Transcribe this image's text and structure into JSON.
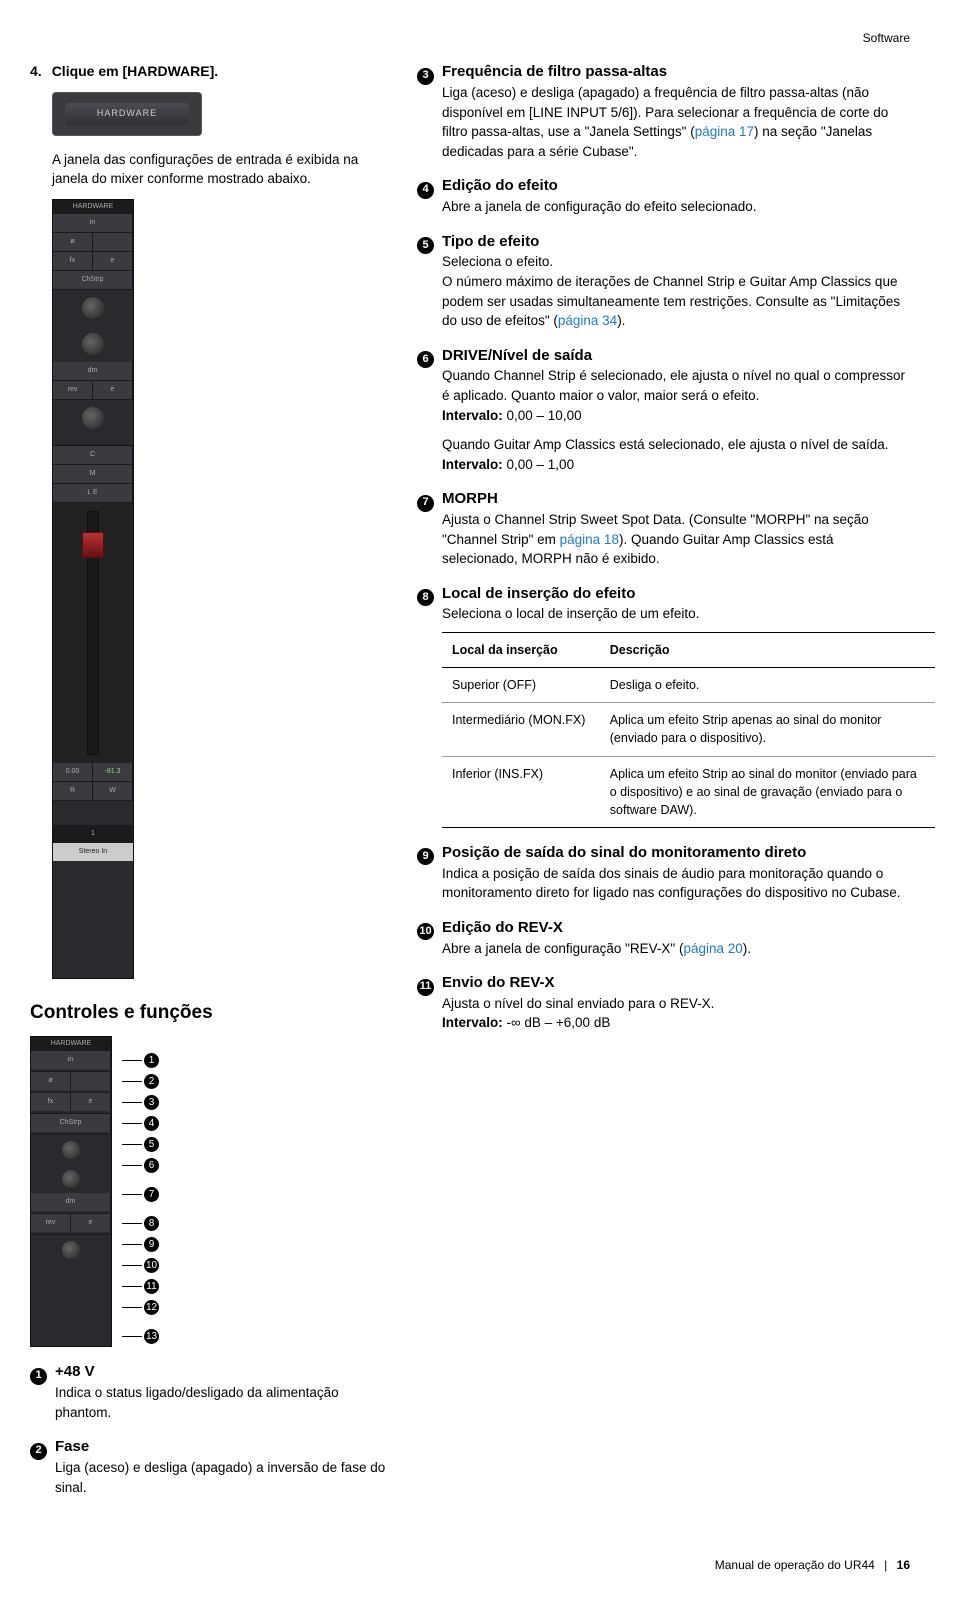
{
  "header": {
    "section": "Software"
  },
  "step": {
    "num": "4.",
    "text": "Clique em [HARDWARE].",
    "note": "A janela das configurações de entrada é exibida na janela do mixer conforme mostrado abaixo.",
    "thumbLabel": "HARDWARE"
  },
  "controls": {
    "heading": "Controles e funções",
    "panelTitle": "HARDWARE"
  },
  "items": {
    "i1": {
      "title": "+48 V",
      "body": "Indica o status ligado/desligado da alimentação phantom."
    },
    "i2": {
      "title": "Fase",
      "body": "Liga (aceso) e desliga (apagado) a inversão de fase do sinal."
    },
    "i3": {
      "title": "Frequência de filtro passa-altas",
      "body1": "Liga (aceso) e desliga (apagado) a frequência de filtro passa-altas (não disponível em [LINE INPUT 5/6]). Para selecionar a frequência de corte do filtro passa-altas, use a \"Janela Settings\" (",
      "link1": "página 17",
      "body2": ") na seção \"Janelas dedicadas para a série Cubase\"."
    },
    "i4": {
      "title": "Edição do efeito",
      "body": "Abre a janela de configuração do efeito selecionado."
    },
    "i5": {
      "title": "Tipo de efeito",
      "body1": "Seleciona o efeito.",
      "body2": "O número máximo de iterações de Channel Strip e Guitar Amp Classics que podem ser usadas simultaneamente tem restrições. Consulte as \"Limitações do uso de efeitos\" (",
      "link": "página 34",
      "body3": ")."
    },
    "i6": {
      "title": "DRIVE/Nível de saída",
      "body1": "Quando Channel Strip é selecionado, ele ajusta o nível no qual o compressor é aplicado. Quanto maior o valor, maior será o efeito.",
      "intervalLabel1": "Intervalo:",
      "interval1": " 0,00 – 10,00",
      "body2": "Quando Guitar Amp Classics está selecionado, ele ajusta o nível de saída.",
      "intervalLabel2": "Intervalo:",
      "interval2": " 0,00 – 1,00"
    },
    "i7": {
      "title": "MORPH",
      "body1": "Ajusta o Channel Strip Sweet Spot Data. (Consulte \"MORPH\" na seção \"Channel Strip\" em ",
      "link": "página 18",
      "body2": "). Quando Guitar Amp Classics está selecionado, MORPH não é exibido."
    },
    "i8": {
      "title": "Local de inserção do efeito",
      "intro": "Seleciona o local de inserção de um efeito."
    },
    "i9": {
      "title": "Posição de saída do sinal do monitoramento direto",
      "body": "Indica a posição de saída dos sinais de áudio para monitoração quando o monitoramento direto for ligado nas configurações do dispositivo no Cubase."
    },
    "i10": {
      "title": "Edição do REV-X",
      "body1": "Abre a janela de configuração \"REV-X\" (",
      "link": "página 20",
      "body2": ")."
    },
    "i11": {
      "title": "Envio do REV-X",
      "body": "Ajusta o nível do sinal enviado para o REV-X.",
      "intervalLabel": "Intervalo:",
      "interval": " -∞ dB – +6,00 dB"
    }
  },
  "table": {
    "h1": "Local da inserção",
    "h2": "Descrição",
    "r1c1": "Superior (OFF)",
    "r1c2": "Desliga o efeito.",
    "r2c1": "Intermediário (MON.FX)",
    "r2c2": "Aplica um efeito Strip apenas ao sinal do monitor (enviado para o dispositivo).",
    "r3c1": "Inferior (INS.FX)",
    "r3c2": "Aplica um efeito Strip ao sinal do monitor (enviado para o dispositivo) e ao sinal de gravação (enviado para o software DAW)."
  },
  "footer": {
    "doc": "Manual de operação do UR44",
    "page": "16"
  },
  "miniPanelLabels": {
    "in": "in",
    "phi": "ø",
    "e": "e",
    "fx": "fx",
    "chstrp": "ChStrp",
    "dm": "dm",
    "rev": "rev",
    "stereoIn": "Stereo In",
    "zero": "0.00",
    "neg": "-81.3",
    "r": "R",
    "w": "W",
    "one": "1",
    "c": "C",
    "m": "M",
    "le": "L E"
  },
  "nums": {
    "n1": "1",
    "n2": "2",
    "n3": "3",
    "n4": "4",
    "n5": "5",
    "n6": "6",
    "n7": "7",
    "n8": "8",
    "n9": "9",
    "n10": "10",
    "n11": "11",
    "n12": "12",
    "n13": "13"
  }
}
